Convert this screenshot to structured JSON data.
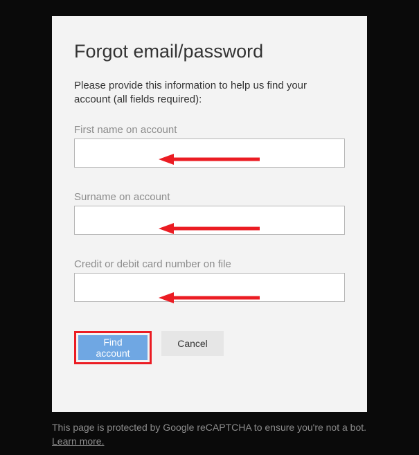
{
  "title": "Forgot email/password",
  "subtitle": "Please provide this information to help us find your account (all fields required):",
  "fields": {
    "firstname": {
      "label": "First name on account",
      "value": ""
    },
    "surname": {
      "label": "Surname on account",
      "value": ""
    },
    "card": {
      "label": "Credit or debit card number on file",
      "value": ""
    }
  },
  "buttons": {
    "find": "Find account",
    "cancel": "Cancel"
  },
  "footer": {
    "text": "This page is protected by Google reCAPTCHA to ensure you're not a bot. ",
    "link": "Learn more."
  },
  "annotations": {
    "arrow_color": "#eb1c23",
    "highlight_color": "#eb1c23"
  }
}
